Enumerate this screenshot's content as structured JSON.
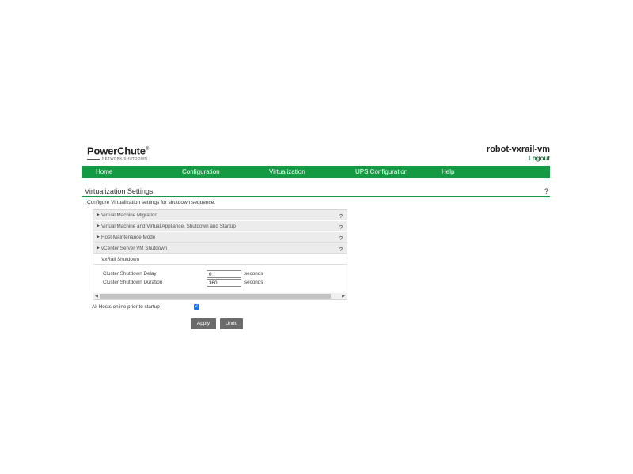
{
  "header": {
    "brand": "PowerChute",
    "brand_mark": "®",
    "brand_sub": "NETWORK SHUTDOWN",
    "hostname": "robot-vxrail-vm",
    "logout": "Logout"
  },
  "nav": {
    "items": [
      {
        "label": "Home"
      },
      {
        "label": "Configuration"
      },
      {
        "label": "Virtualization"
      },
      {
        "label": "UPS Configuration"
      },
      {
        "label": "Help"
      }
    ]
  },
  "section": {
    "title": "Virtualization Settings",
    "help": "?",
    "description": "Configure Virtualization settings for shutdown sequence."
  },
  "accordion": {
    "rows": [
      {
        "label": "Virtual Machine Migration",
        "help": "?"
      },
      {
        "label": "Virtual Machine and Virtual Appliance, Shutdown and Startup",
        "help": "?"
      },
      {
        "label": "Host Maintenance Mode",
        "help": "?"
      },
      {
        "label": "vCenter Server VM Shutdown",
        "help": "?"
      }
    ],
    "subheading": "VxRail Shutdown",
    "fields": [
      {
        "label": "Cluster Shutdown Delay",
        "value": "0",
        "unit": "seconds"
      },
      {
        "label": "Cluster Shutdown Duration",
        "value": "360",
        "unit": "seconds"
      }
    ]
  },
  "options": {
    "all_hosts_label": "All Hosts online prior to startup",
    "all_hosts_checked": true,
    "check_glyph": "✓"
  },
  "buttons": {
    "apply": "Apply",
    "undo": "Undo"
  },
  "icons": {
    "expand": "▶",
    "scroll_left": "◀",
    "scroll_right": "▶"
  },
  "colors": {
    "nav_green": "#139a43",
    "logout_green": "#1a6b3c",
    "button_gray": "#6b6b6b",
    "checkbox_blue": "#1a73e8"
  }
}
